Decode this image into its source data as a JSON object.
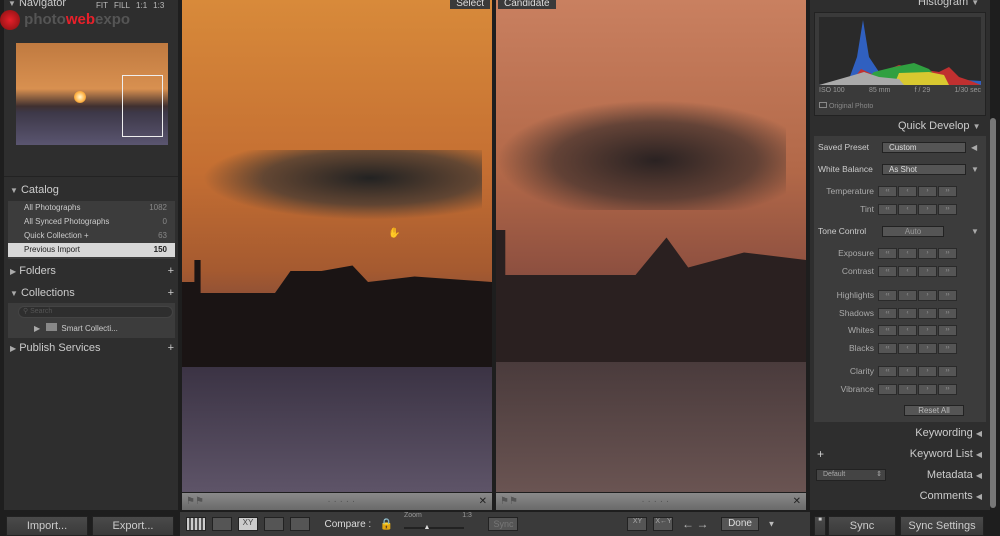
{
  "navigator": {
    "title": "Navigator",
    "zoom_options": [
      "FIT",
      "FILL",
      "1:1",
      "1:3"
    ],
    "watermark": "photowebexpo"
  },
  "catalog": {
    "title": "Catalog",
    "items": [
      {
        "label": "All Photographs",
        "count": "1082"
      },
      {
        "label": "All Synced Photographs",
        "count": "0"
      },
      {
        "label": "Quick Collection +",
        "count": "63"
      },
      {
        "label": "Previous Import",
        "count": "150",
        "selected": true
      }
    ]
  },
  "folders": {
    "title": "Folders"
  },
  "collections": {
    "title": "Collections",
    "search_placeholder": "Search",
    "items": [
      {
        "label": "Smart Collecti..."
      }
    ]
  },
  "publish": {
    "title": "Publish Services"
  },
  "left_buttons": {
    "import": "Import...",
    "export": "Export..."
  },
  "compare": {
    "select_label": "Select",
    "candidate_label": "Candidate",
    "close": "✕"
  },
  "toolbar": {
    "compare_label": "Compare :",
    "zoom_label": "Zoom",
    "zoom_value": "1:3",
    "zoom_level": 0.35,
    "sync": "Sync",
    "done": "Done",
    "xy": "XY"
  },
  "histogram": {
    "title": "Histogram",
    "iso": "ISO 100",
    "focal": "85 mm",
    "aperture": "f / 29",
    "shutter": "1/30 sec",
    "original_photo": "Original Photo"
  },
  "quick_develop": {
    "title": "Quick Develop",
    "saved_preset": {
      "label": "Saved Preset",
      "value": "Custom"
    },
    "white_balance": {
      "label": "White Balance",
      "value": "As Shot",
      "rows": [
        "Temperature",
        "Tint"
      ]
    },
    "tone_control": {
      "label": "Tone Control",
      "auto": "Auto",
      "groups": [
        [
          "Exposure",
          "Contrast"
        ],
        [
          "Highlights",
          "Shadows",
          "Whites",
          "Blacks"
        ],
        [
          "Clarity",
          "Vibrance"
        ]
      ]
    },
    "reset_all": "Reset All"
  },
  "right_sections": {
    "keywording": "Keywording",
    "keyword_list": "Keyword List",
    "metadata": "Metadata",
    "metadata_preset": "Default",
    "comments": "Comments"
  },
  "right_buttons": {
    "sync": "Sync",
    "sync_settings": "Sync Settings"
  },
  "colors": {
    "panel": "#333333",
    "accent_red": "#e8202a",
    "selected_row": "#d8d8d8"
  }
}
